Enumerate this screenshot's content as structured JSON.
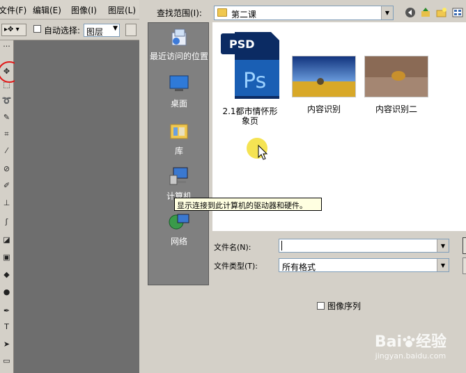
{
  "ps": {
    "menu": [
      "文件(F)",
      "编辑(E)",
      "图像(I)",
      "图层(L)"
    ],
    "options": {
      "auto_select_label": "自动选择:",
      "auto_select_value": "图层"
    }
  },
  "dialog": {
    "look_in_label": "查找范围(I):",
    "look_in_value": "第二课",
    "places": [
      {
        "label": "最近访问的位置",
        "icon": "recent-places-icon"
      },
      {
        "label": "桌面",
        "icon": "desktop-icon"
      },
      {
        "label": "库",
        "icon": "libraries-icon"
      },
      {
        "label": "计算机",
        "icon": "computer-icon"
      },
      {
        "label": "网络",
        "icon": "network-icon"
      }
    ],
    "files": [
      {
        "name": "2.1都市情怀形象页",
        "icon": "psd-file-icon",
        "badge": "PSD",
        "app": "Ps"
      },
      {
        "name": "内容识别",
        "icon": "image-thumbnail"
      },
      {
        "name": "内容识别二",
        "icon": "image-thumbnail"
      }
    ],
    "filename_label": "文件名(N):",
    "filename_value": "",
    "filetype_label": "文件类型(T):",
    "filetype_value": "所有格式",
    "tooltip": "显示连接到此计算机的驱动器和硬件。",
    "sequence_label": "图像序列"
  },
  "watermark": {
    "brand": "Bai",
    "brand_tail": "经验",
    "url": "jingyan.baidu.com"
  },
  "colors": {
    "dialog_bg": "#d4d0c8",
    "places_bg": "#808080",
    "tooltip_bg": "#ffffe1",
    "highlight_circle": "#e01818",
    "cursor_highlight": "#f4e040"
  }
}
